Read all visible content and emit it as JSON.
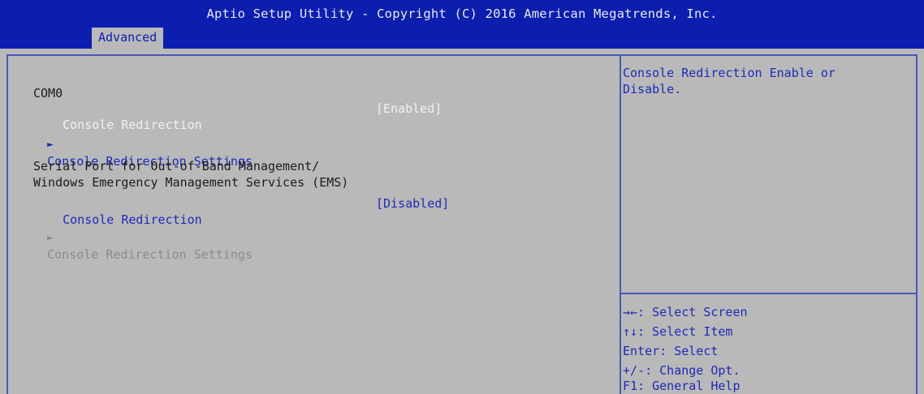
{
  "header": {
    "title": "Aptio Setup Utility - Copyright (C) 2016 American Megatrends, Inc.",
    "active_tab": "Advanced"
  },
  "main": {
    "section_com": "COM0",
    "console_redirection_label": "Console Redirection",
    "console_redirection_value": "[Enabled]",
    "console_redirection_settings": "Console Redirection Settings",
    "ems_heading_line1": "Serial Port for Out-of-Band Management/",
    "ems_heading_line2": "Windows Emergency Management Services (EMS)",
    "ems_console_redirection_label": "Console Redirection",
    "ems_console_redirection_value": "[Disabled]",
    "ems_console_redirection_settings": "Console Redirection Settings",
    "submenu_arrow": "►"
  },
  "help": {
    "description": "Console Redirection Enable or\nDisable.",
    "keys": [
      "→←: Select Screen",
      "↑↓: Select Item",
      "Enter: Select",
      "+/-: Change Opt.",
      "F1: General Help"
    ]
  },
  "colors": {
    "title_bar": "#0c1eb0",
    "background": "#b9b9b9",
    "link_text": "#1f2ab6",
    "selected_text": "#f2f2f2",
    "disabled_text": "#8c8c8c"
  }
}
